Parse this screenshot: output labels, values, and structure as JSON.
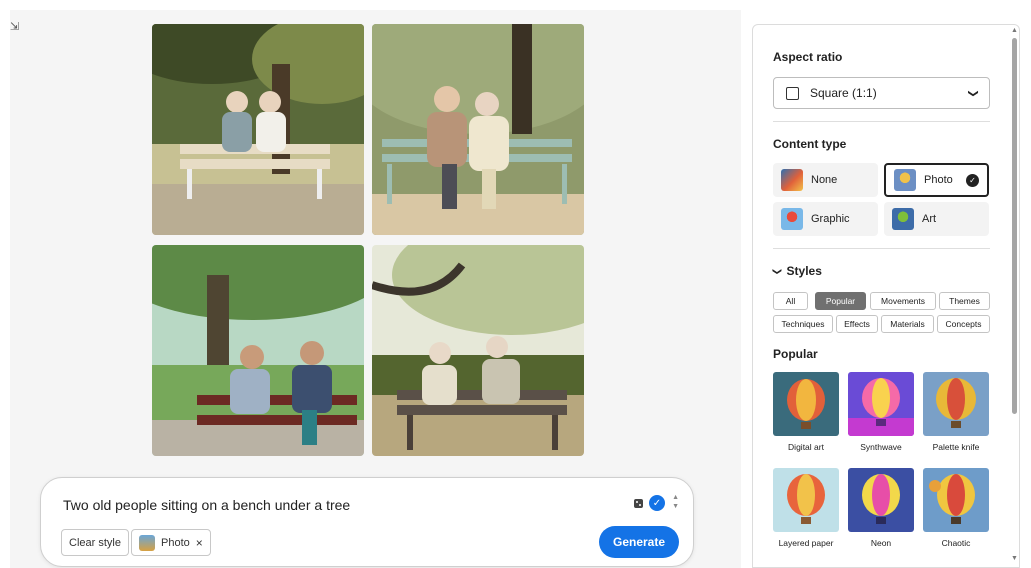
{
  "prompt": {
    "text": "Two old people sitting on a bench under a tree",
    "clear_style_label": "Clear style",
    "style_chip_label": "Photo",
    "style_chip_remove": "×",
    "generate_label": "Generate"
  },
  "panel": {
    "aspect_ratio": {
      "title": "Aspect ratio",
      "selected": "Square (1:1)"
    },
    "content_type": {
      "title": "Content type",
      "options": [
        {
          "label": "None",
          "selected": false
        },
        {
          "label": "Photo",
          "selected": true
        },
        {
          "label": "Graphic",
          "selected": false
        },
        {
          "label": "Art",
          "selected": false
        }
      ]
    },
    "styles": {
      "title": "Styles",
      "filters": [
        "All",
        "Popular",
        "Movements",
        "Themes",
        "Techniques",
        "Effects",
        "Materials",
        "Concepts"
      ],
      "active_filter": "Popular",
      "section_label": "Popular",
      "items": [
        {
          "label": "Digital art"
        },
        {
          "label": "Synthwave"
        },
        {
          "label": "Palette knife"
        },
        {
          "label": "Layered paper"
        },
        {
          "label": "Neon"
        },
        {
          "label": "Chaotic"
        }
      ]
    }
  },
  "colors": {
    "accent": "#1473e6",
    "selected_border": "#222222",
    "active_filter": "#707070"
  },
  "icons": {
    "aspect": "square-icon",
    "dropdown": "chevron-down-icon",
    "prompt_dice": "dice-icon",
    "prompt_check": "check-circle-icon",
    "selected_check": "checkmark-icon"
  }
}
